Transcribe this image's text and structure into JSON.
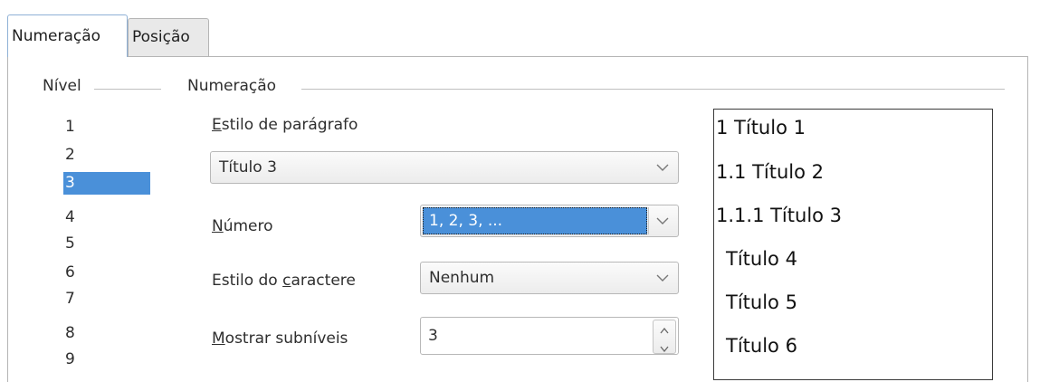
{
  "tabs": [
    {
      "label": "Numeração",
      "active": true
    },
    {
      "label": "Posição",
      "active": false
    }
  ],
  "level": {
    "group_label": "Nível",
    "items": [
      "1",
      "2",
      "3",
      "4",
      "5",
      "6",
      "7",
      "8",
      "9"
    ],
    "selected": "3"
  },
  "numbering": {
    "group_label": "Numeração",
    "paragraph_style": {
      "label": "Estilo de parágrafo",
      "value": "Título 3"
    },
    "number": {
      "label": "Número",
      "value": "1, 2, 3, ..."
    },
    "char_style": {
      "label": "Estilo do caractere",
      "value": "Nenhum"
    },
    "sublevels": {
      "label": "Mostrar subníveis",
      "value": "3"
    }
  },
  "preview": {
    "lines": [
      "1 Título 1",
      "1.1 Título 2",
      "1.1.1 Título 3",
      "Título 4",
      "Título 5",
      "Título 6"
    ]
  },
  "colors": {
    "selection": "#4a90d9",
    "tab_active_border": "#8fb1d6"
  },
  "icons": [
    "chevron-down-icon",
    "spin-up-icon",
    "spin-down-icon"
  ]
}
